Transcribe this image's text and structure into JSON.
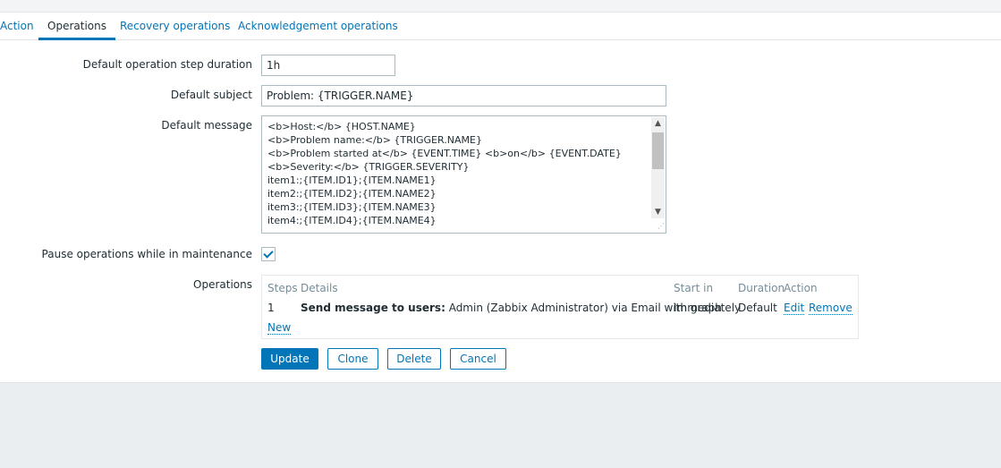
{
  "tabs": [
    {
      "label": "Action",
      "active": false
    },
    {
      "label": "Operations",
      "active": true
    },
    {
      "label": "Recovery operations",
      "active": false
    },
    {
      "label": "Acknowledgement operations",
      "active": false
    }
  ],
  "form": {
    "step_duration_label": "Default operation step duration",
    "step_duration_value": "1h",
    "subject_label": "Default subject",
    "subject_value": "Problem: {TRIGGER.NAME}",
    "message_label": "Default message",
    "message_lines": [
      "<b>Host:</b> {HOST.NAME}",
      "<b>Problem name:</b> {TRIGGER.NAME}",
      "<b>Problem started at</b> {EVENT.TIME} <b>on</b> {EVENT.DATE}",
      "<b>Severity:</b> {TRIGGER.SEVERITY}",
      "item1:;{ITEM.ID1};{ITEM.NAME1}",
      "item2:;{ITEM.ID2};{ITEM.NAME2}",
      "item3:;{ITEM.ID3};{ITEM.NAME3}",
      "item4:;{ITEM.ID4};{ITEM.NAME4}"
    ],
    "pause_label": "Pause operations while in maintenance",
    "pause_checked": true,
    "operations_label": "Operations"
  },
  "operations_table": {
    "headers": {
      "steps": "Steps",
      "details": "Details",
      "start_in": "Start in",
      "duration": "Duration",
      "action": "Action"
    },
    "rows": [
      {
        "steps": "1",
        "details_bold": "Send message to users:",
        "details_rest": " Admin (Zabbix Administrator) via Email with graph",
        "start_in": "Immediately",
        "duration": "Default",
        "edit": "Edit",
        "remove": "Remove"
      }
    ],
    "new_link": "New"
  },
  "buttons": {
    "update": "Update",
    "clone": "Clone",
    "delete": "Delete",
    "cancel": "Cancel"
  },
  "colors": {
    "accent": "#0275b8",
    "text": "#1f2c33",
    "muted": "#768d99",
    "border": "#acbbc2",
    "background": "#ebeef0"
  },
  "icons": {
    "checkbox": "check-icon",
    "scroll_up": "chevron-up-icon",
    "scroll_down": "chevron-down-icon"
  }
}
